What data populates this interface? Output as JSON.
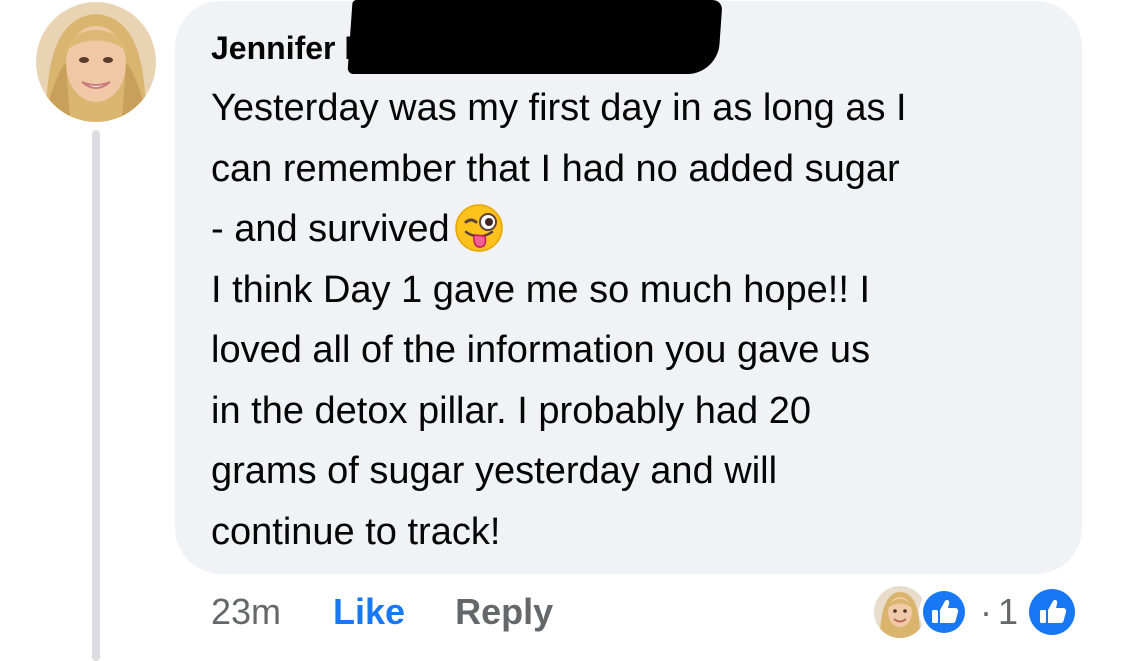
{
  "comment": {
    "author": "Jennifer I",
    "lines": [
      "Yesterday was my first day in as long as I",
      "can remember that I had no added sugar",
      "- and survived",
      "I think Day 1 gave me so much hope!!  I",
      "loved all of the information you gave us",
      "in the detox pillar.  I probably had 20",
      "grams of sugar yesterday and will",
      "continue to track!"
    ],
    "emoji": "winking-face-with-tongue",
    "timestamp": "23m",
    "like_label": "Like",
    "reply_label": "Reply",
    "reaction_dot": "·",
    "reaction_count": "1"
  },
  "icons": {
    "avatar": "user-avatar",
    "like": "thumbs-up-icon"
  },
  "colors": {
    "bubble": "#f0f2f5",
    "text": "#050505",
    "secondary": "#65676b",
    "accent": "#1877f2",
    "redaction": "#000000"
  }
}
